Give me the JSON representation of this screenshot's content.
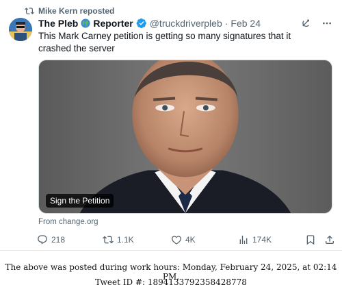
{
  "repost": {
    "label": "Mike Kern reposted"
  },
  "author": {
    "display_name_part1": "The Pleb",
    "display_name_part2": "Reporter",
    "handle": "@truckdriverpleb",
    "separator": "·",
    "date": "Feb 24"
  },
  "tweet": {
    "text": "This Mark Carney petition is getting so many signatures that it crashed the server"
  },
  "media": {
    "card_label": "Sign the Petition",
    "source": "From change.org"
  },
  "metrics": {
    "replies": "218",
    "reposts": "1.1K",
    "likes": "4K",
    "views": "174K"
  },
  "footer": {
    "line1": "The above was posted during work hours: Monday, February 24, 2025, at 02:14 PM.",
    "line2": "Tweet ID #: 1894133792358428778"
  },
  "colors": {
    "verified": "#1d9bf0",
    "muted": "#536471",
    "text": "#0f1419"
  },
  "icons": [
    "repost-icon",
    "globe-icon",
    "verified-badge-icon",
    "grok-icon",
    "more-icon",
    "reply-icon",
    "retweet-icon",
    "like-icon",
    "views-icon",
    "bookmark-icon",
    "share-icon"
  ]
}
